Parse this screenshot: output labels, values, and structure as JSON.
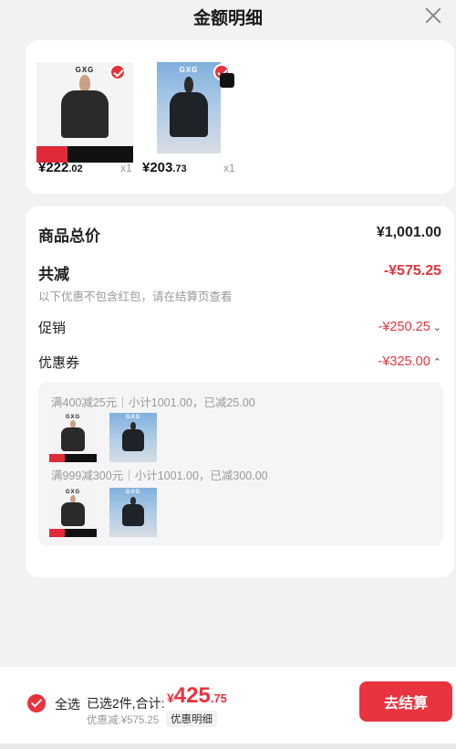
{
  "header": {
    "title": "金额明细"
  },
  "products": [
    {
      "brand": "GXG",
      "price_int": "¥222",
      "price_dec": ".02",
      "qty": "x1"
    },
    {
      "brand": "GXG",
      "price_int": "¥203",
      "price_dec": ".73",
      "qty": "x1"
    }
  ],
  "summary": {
    "total_label": "商品总价",
    "total_value": "¥1,001.00",
    "reduce_label": "共减",
    "reduce_value": "-¥575.25",
    "note": "以下优惠不包含红包，请在结算页查看",
    "promo_label": "促销",
    "promo_value": "-¥250.25",
    "coupon_label": "优惠券",
    "coupon_value": "-¥325.00",
    "rules": [
      "满400减25元｜小计1001.00，已减25.00",
      "满999减300元｜小计1001.00，已减300.00"
    ]
  },
  "bottom": {
    "select_all": "全选",
    "selected_text": "已选2件,合计:",
    "currency": "¥",
    "total_int": "425",
    "total_dec": ".75",
    "discount_text": "优惠减:¥575.25",
    "detail_label": "优惠明细",
    "checkout_label": "去结算"
  },
  "colors": {
    "accent": "#e8333d",
    "background": "#f2f2f2"
  },
  "icons": [
    "close-icon",
    "checkmark-icon",
    "caret-down-icon",
    "caret-up-icon"
  ]
}
